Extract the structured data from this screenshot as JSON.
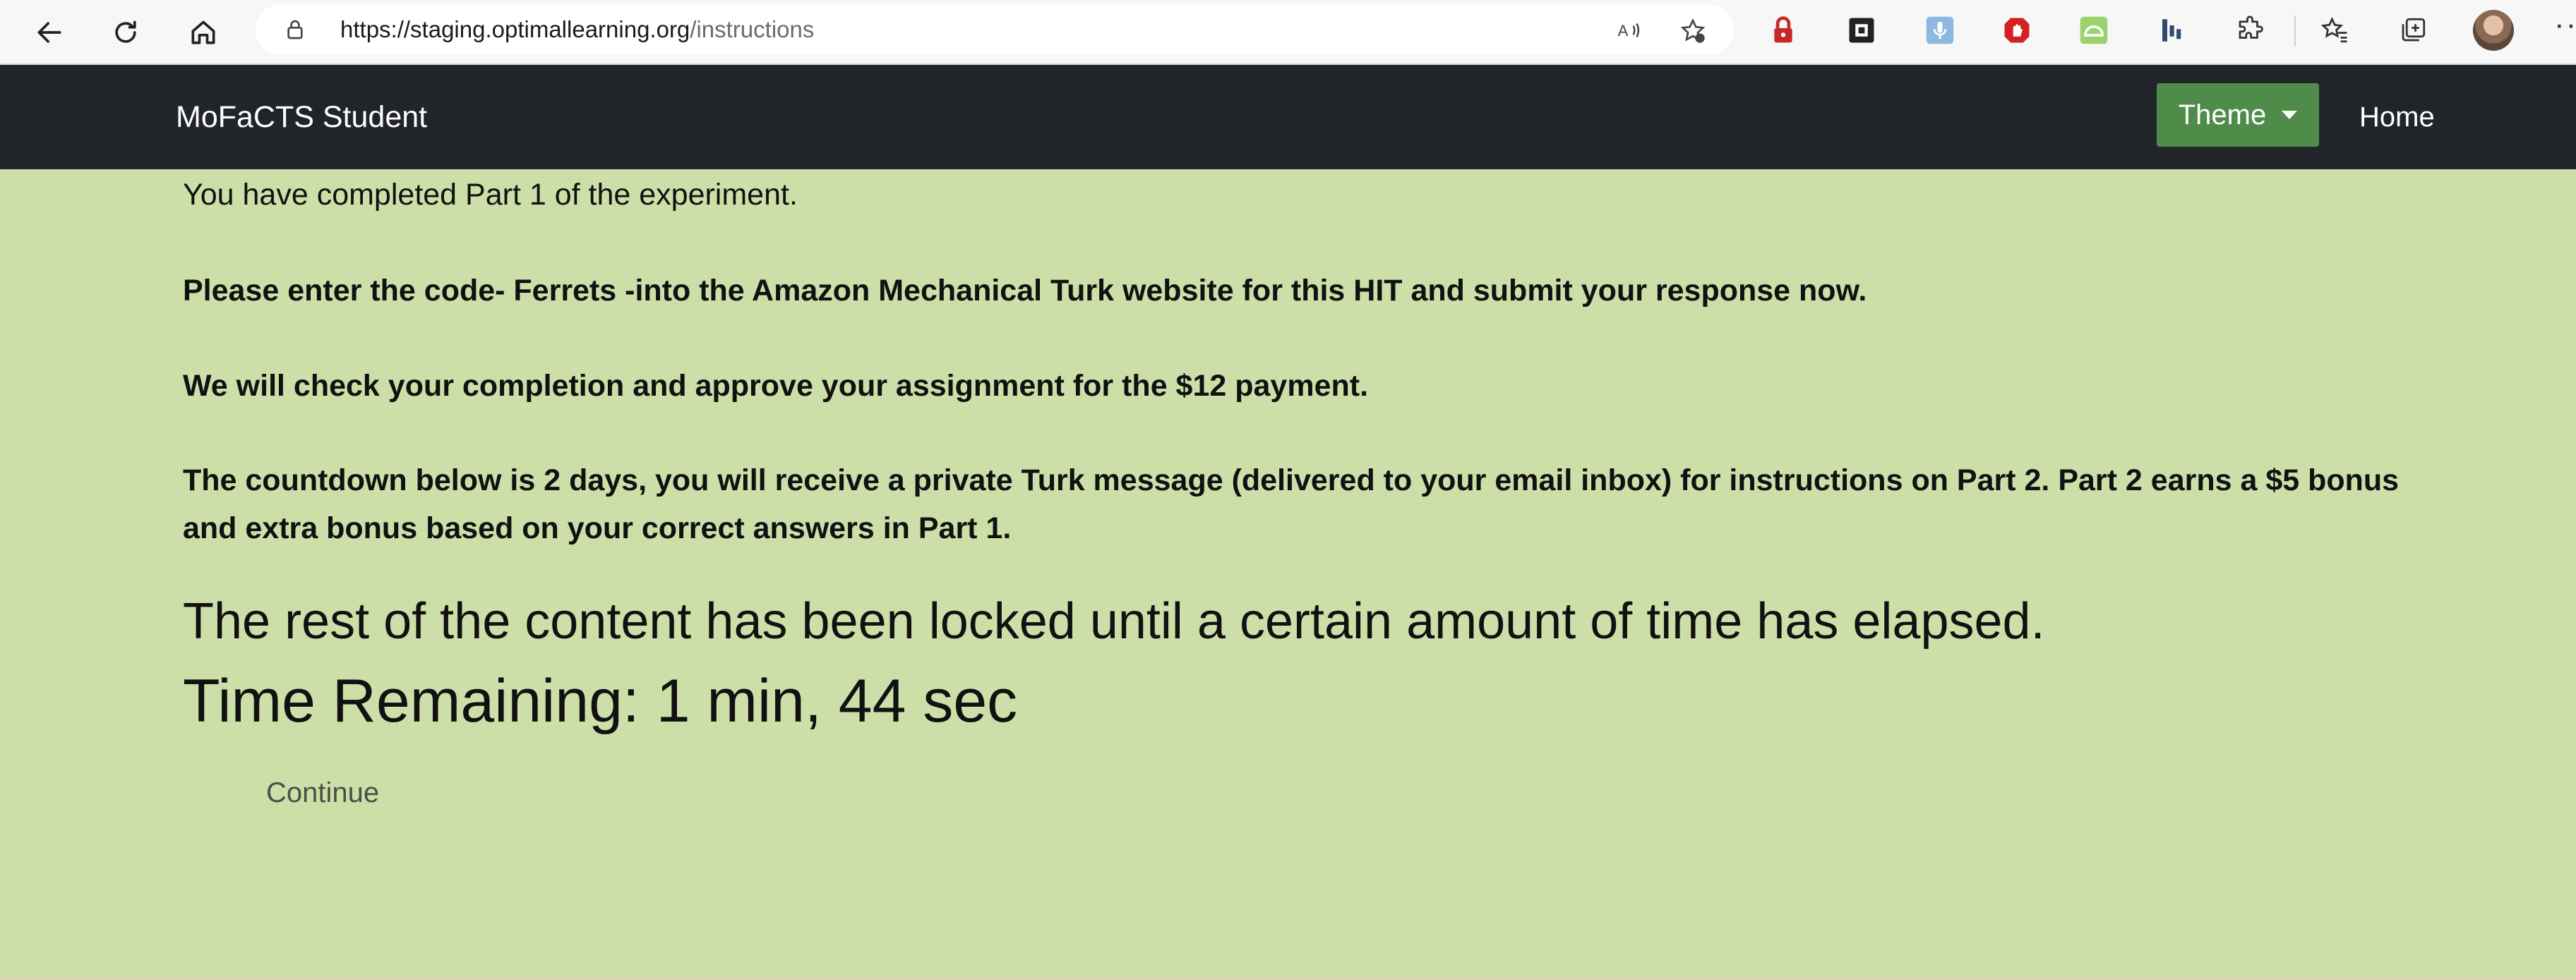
{
  "browser": {
    "url_host": "https://staging.optimallearning.org",
    "url_path": "/instructions",
    "icons": [
      "back-icon",
      "refresh-icon",
      "home-icon",
      "lock-icon",
      "read-aloud-icon",
      "add-favorite-icon",
      "extension-icons",
      "favorites-icon",
      "collections-icon",
      "profile-avatar",
      "more-icon"
    ],
    "more_label": "···"
  },
  "navbar": {
    "brand": "MoFaCTS Student",
    "theme_label": "Theme",
    "home_label": "Home",
    "theme_color": "#4f8c4a",
    "background_color": "#212529"
  },
  "content": {
    "completed_text": "You have completed Part 1 of the experiment.",
    "code_text": "Please enter the code- Ferrets -into the Amazon Mechanical Turk website for this HIT and submit your response now.",
    "check_text": "We will check your completion and approve your assignment for the $12 payment.",
    "countdown_text": "The countdown below is 2 days, you will receive a private Turk message (delivered to your email inbox) for instructions on Part 2. Part 2 earns a $5 bonus and extra bonus based on your correct answers in Part 1.",
    "locked_text": "The rest of the content has been locked until a certain amount of time has elapsed.",
    "time_remaining": "Time Remaining: 1 min, 44 sec",
    "continue_label": "Continue",
    "background_color": "#cddfa8"
  }
}
